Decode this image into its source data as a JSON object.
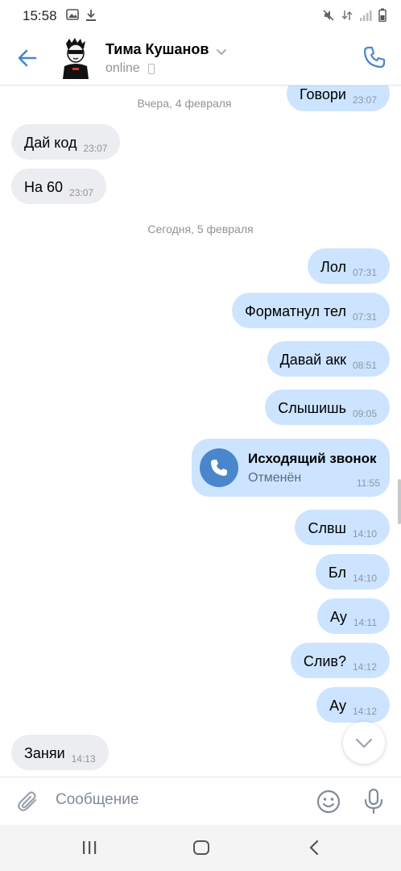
{
  "status_bar": {
    "time": "15:58"
  },
  "header": {
    "contact_name": "Тима Кушанов",
    "status": "online"
  },
  "chat": {
    "top_partial": {
      "text": "Говори",
      "time": "23:07"
    },
    "date_separators": [
      "Вчера, 4 февраля",
      "Сегодня, 5 февраля"
    ],
    "messages": [
      {
        "direction": "in",
        "text": "Дай код",
        "time": "23:07"
      },
      {
        "direction": "in",
        "text": "На 60",
        "time": "23:07"
      },
      {
        "direction": "out",
        "text": "Лол",
        "time": "07:31"
      },
      {
        "direction": "out",
        "text": "Форматнул тел",
        "time": "07:31"
      },
      {
        "direction": "out",
        "text": "Давай акк",
        "time": "08:51"
      },
      {
        "direction": "out",
        "text": "Слышишь",
        "time": "09:05"
      },
      {
        "direction": "out",
        "text": "Слвш",
        "time": "14:10"
      },
      {
        "direction": "out",
        "text": "Бл",
        "time": "14:10"
      },
      {
        "direction": "out",
        "text": "Ау",
        "time": "14:11"
      },
      {
        "direction": "out",
        "text": "Слив?",
        "time": "14:12"
      },
      {
        "direction": "out",
        "text": "Ау",
        "time": "14:12"
      },
      {
        "direction": "in",
        "text": "Заняи",
        "time": "14:13"
      }
    ],
    "call": {
      "title": "Исходящий звонок",
      "subtitle": "Отменён",
      "time": "11:55"
    }
  },
  "composer": {
    "placeholder": "Сообщение"
  },
  "colors": {
    "accent": "#4986cc",
    "bubble_out": "#cce4ff",
    "bubble_in": "#ebedf0"
  },
  "icons": [
    "back-arrow-icon",
    "chevron-down-icon",
    "phone-icon",
    "paperclip-icon",
    "smile-icon",
    "microphone-icon",
    "recent-apps-icon",
    "home-icon",
    "nav-back-icon"
  ]
}
